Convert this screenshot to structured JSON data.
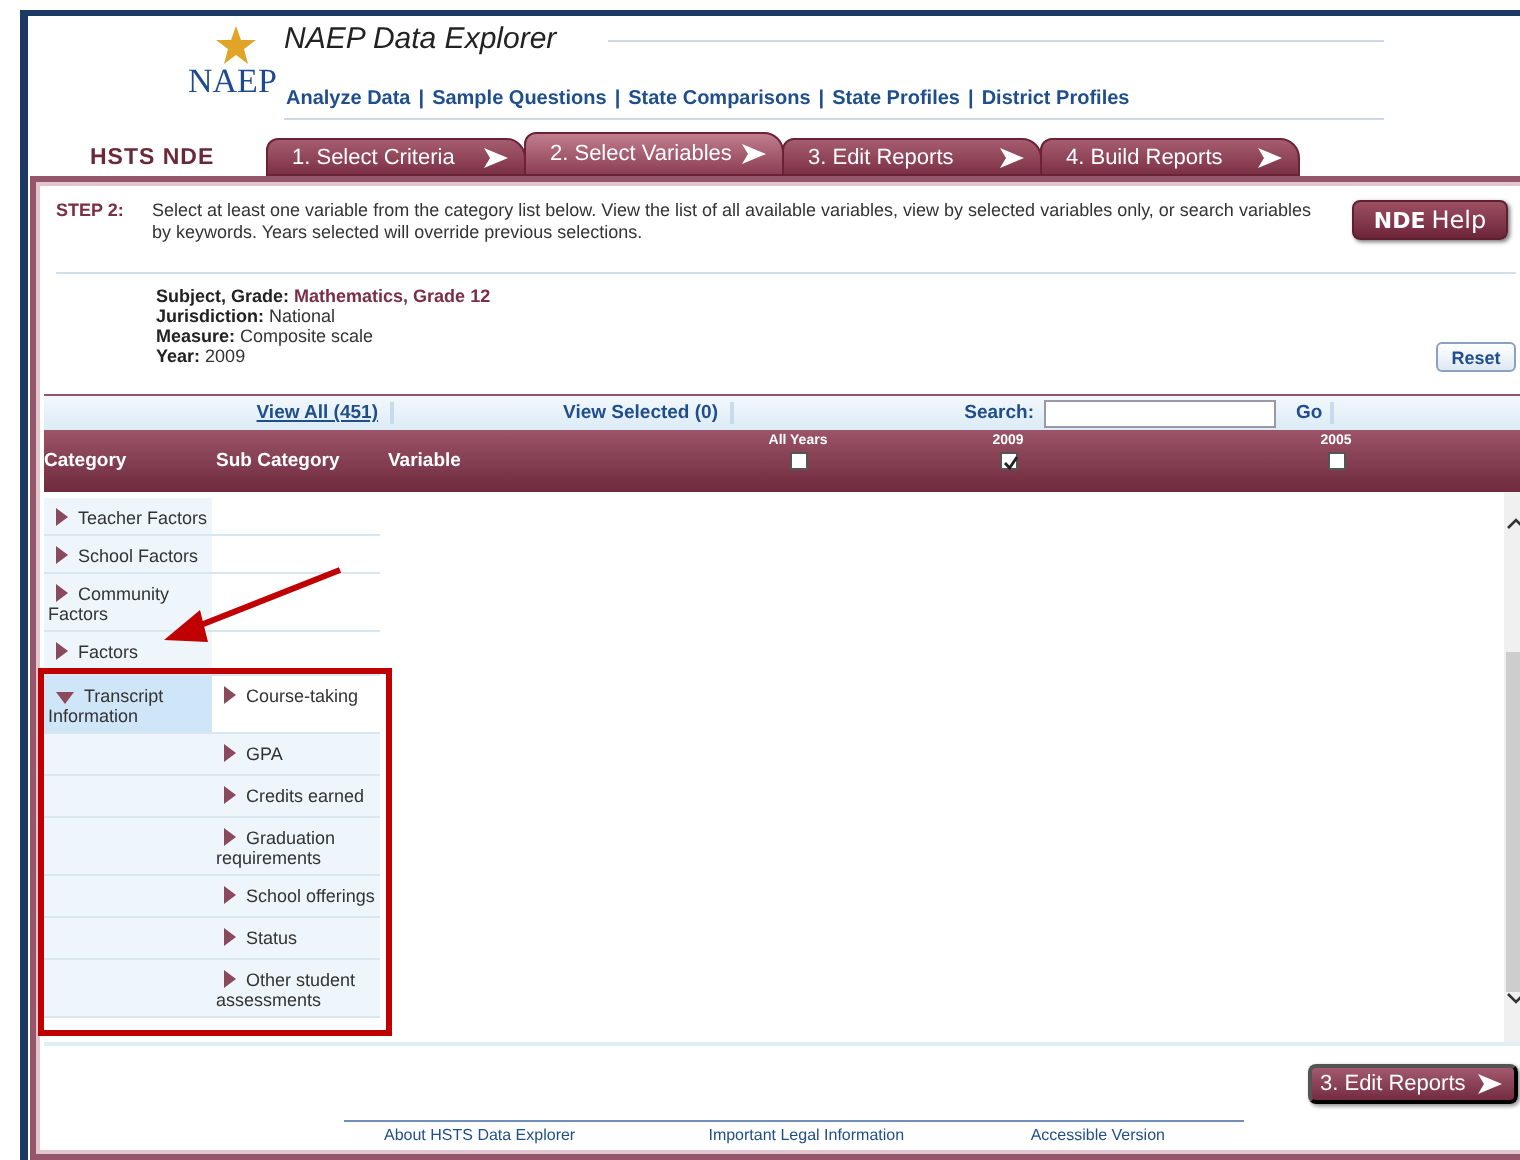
{
  "header": {
    "logo_text": "NAEP",
    "title": "NAEP Data Explorer",
    "nav_separator": "|",
    "nav_links": [
      "Analyze Data",
      "Sample Questions",
      "State Comparisons",
      "State Profiles",
      "District Profiles"
    ]
  },
  "app_label": "HSTS NDE",
  "tabs": [
    {
      "label": "1.  Select Criteria",
      "selected": false
    },
    {
      "label": "2.  Select Variables",
      "selected": true
    },
    {
      "label": "3.  Edit Reports",
      "selected": false
    },
    {
      "label": "4.  Build Reports",
      "selected": false
    }
  ],
  "step": {
    "label": "STEP 2:",
    "text": "Select at least one variable from the category list below. View the list of all available variables, view by selected variables only, or search variables by keywords. Years selected will override previous selections."
  },
  "help_button": "**NDE** Help",
  "criteria": [
    {
      "label": "Subject, Grade:",
      "value": "Mathematics, Grade 12",
      "emphasis": true
    },
    {
      "label": "Jurisdiction:",
      "value": "National",
      "emphasis": false
    },
    {
      "label": "Measure:",
      "value": "Composite scale",
      "emphasis": false
    },
    {
      "label": "Year:",
      "value": "2009",
      "emphasis": false
    }
  ],
  "reset_button": "Reset",
  "toolbar": {
    "view_all": "View All (451)",
    "view_selected": "View Selected (0)",
    "search_label": "Search:",
    "go_button": "Go"
  },
  "columns": [
    "Category",
    "Sub Category",
    "Variable"
  ],
  "year_columns": [
    {
      "label": "All Years",
      "checked": false
    },
    {
      "label": "2009",
      "checked": true
    },
    {
      "label": "2005",
      "checked": false
    }
  ],
  "categories": [
    {
      "label": "Teacher Factors",
      "expanded": false,
      "selected": false
    },
    {
      "label": "School Factors",
      "expanded": false,
      "selected": false
    },
    {
      "label": "Community Factors",
      "expanded": false,
      "selected": false
    },
    {
      "label": "Factors",
      "expanded": false,
      "selected": false
    },
    {
      "label": "Transcript Information",
      "expanded": true,
      "selected": true
    }
  ],
  "subcategories": [
    "Course-taking",
    "GPA",
    "Credits earned",
    "Graduation requirements",
    "School offerings",
    "Status",
    "Other student assessments"
  ],
  "next_button": "3. Edit Reports",
  "footer_links": [
    "About HSTS Data Explorer",
    "Important Legal Information",
    "Accessible Version"
  ]
}
